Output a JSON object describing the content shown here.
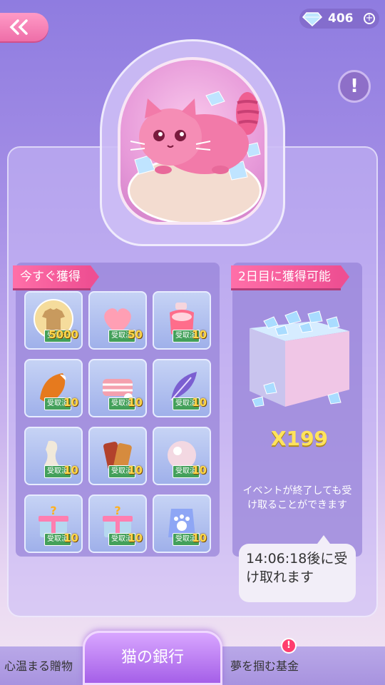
{
  "currency": {
    "amount": "406",
    "plus": "+"
  },
  "info_button": "!",
  "now_section": {
    "title": "今すぐ獲得",
    "items": [
      {
        "icon": "tshirt-icon",
        "badge": "受取済",
        "qty": "5000"
      },
      {
        "icon": "heart-icon",
        "badge": "受取済",
        "qty": "50"
      },
      {
        "icon": "perfume-bottle-icon",
        "badge": "受取済",
        "qty": "10"
      },
      {
        "icon": "fox-tail-icon",
        "badge": "受取済",
        "qty": "10"
      },
      {
        "icon": "fabric-roll-icon",
        "badge": "受取済",
        "qty": "10"
      },
      {
        "icon": "feather-icon",
        "badge": "受取済",
        "qty": "10"
      },
      {
        "icon": "lace-ribbon-icon",
        "badge": "受取済",
        "qty": "10"
      },
      {
        "icon": "leather-swatch-icon",
        "badge": "受取済",
        "qty": "10"
      },
      {
        "icon": "pearl-icon",
        "badge": "受取済",
        "qty": "10"
      },
      {
        "icon": "mystery-gift-box-icon",
        "badge": "受取済",
        "qty": "10"
      },
      {
        "icon": "mystery-gift-box-icon",
        "badge": "受取済",
        "qty": "10"
      },
      {
        "icon": "paw-bag-icon",
        "badge": "受取済",
        "qty": "10"
      }
    ]
  },
  "later_section": {
    "title": "2日目に獲得可能",
    "multiplier": "X199",
    "note": "イベントが終了しても受け取ることができます",
    "timer": "14:06:18後に受け取れます"
  },
  "tabs": {
    "left": "心温まる贈物",
    "center": "猫の銀行",
    "right": "夢を掴む基金",
    "alert": "!"
  },
  "colors": {
    "accent_pink": "#ee4f92",
    "multiplier_gold": "#ffe35c",
    "badge_green": "#43a05a"
  }
}
